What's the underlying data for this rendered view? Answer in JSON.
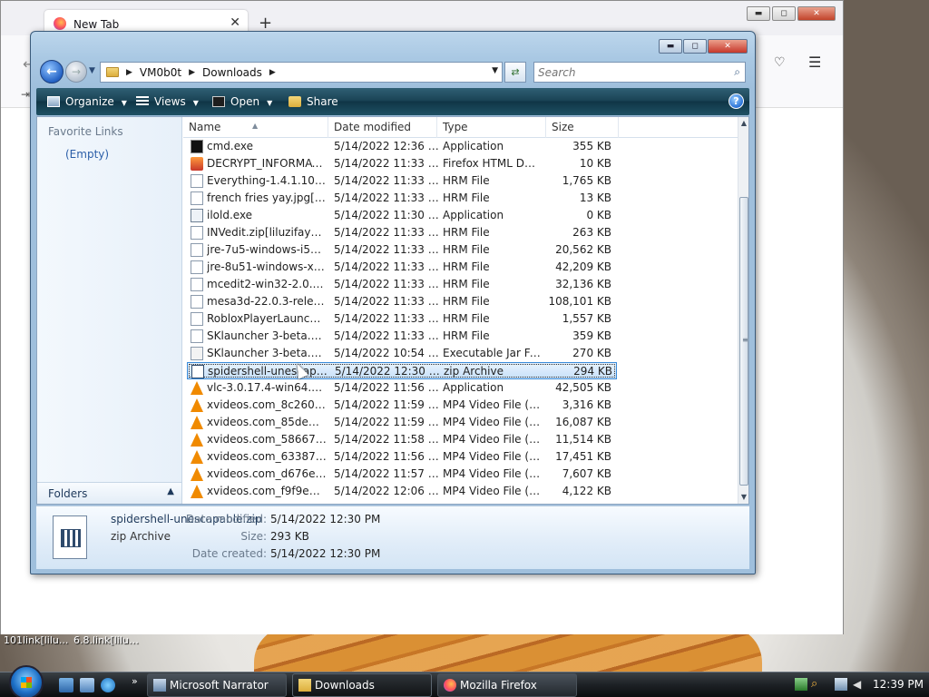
{
  "firefox": {
    "tab_title": "New Tab",
    "tab_close": "✕",
    "new_tab": "+",
    "minimize": "▬",
    "maximize": "◻",
    "close": "✕"
  },
  "explorer": {
    "breadcrumb": [
      "VM0b0t",
      "Downloads"
    ],
    "search_placeholder": "Search",
    "toolbar": {
      "organize": "Organize",
      "views": "Views",
      "open": "Open",
      "share": "Share",
      "help": "?"
    },
    "navpane": {
      "favorite_links": "Favorite Links",
      "empty": "(Empty)",
      "folders": "Folders"
    },
    "columns": {
      "name": "Name",
      "date": "Date modified",
      "type": "Type",
      "size": "Size"
    },
    "files": [
      {
        "name": "cmd.exe",
        "date": "5/14/2022 12:36 PM",
        "type": "Application",
        "size": "355 KB",
        "icon": "cmd"
      },
      {
        "name": "DECRYPT_INFORMATI...",
        "date": "5/14/2022 11:33 AM",
        "type": "Firefox HTML Doc...",
        "size": "10 KB",
        "icon": "html"
      },
      {
        "name": "Everything-1.4.1.1015.x...",
        "date": "5/14/2022 11:33 AM",
        "type": "HRM File",
        "size": "1,765 KB",
        "icon": "blank"
      },
      {
        "name": "french fries yay.jpg[lilu...",
        "date": "5/14/2022 11:33 AM",
        "type": "HRM File",
        "size": "13 KB",
        "icon": "blank"
      },
      {
        "name": "ilold.exe",
        "date": "5/14/2022 11:30 AM",
        "type": "Application",
        "size": "0 KB",
        "icon": "exe"
      },
      {
        "name": "INVedit.zip[liluzifayc@...",
        "date": "5/14/2022 11:33 AM",
        "type": "HRM File",
        "size": "263 KB",
        "icon": "blank"
      },
      {
        "name": "jre-7u5-windows-i586....",
        "date": "5/14/2022 11:33 AM",
        "type": "HRM File",
        "size": "20,562 KB",
        "icon": "blank"
      },
      {
        "name": "jre-8u51-windows-x64....",
        "date": "5/14/2022 11:33 AM",
        "type": "HRM File",
        "size": "42,209 KB",
        "icon": "blank"
      },
      {
        "name": "mcedit2-win32-2.0.0-b...",
        "date": "5/14/2022 11:33 AM",
        "type": "HRM File",
        "size": "32,136 KB",
        "icon": "blank"
      },
      {
        "name": "mesa3d-22.0.3-release...",
        "date": "5/14/2022 11:33 AM",
        "type": "HRM File",
        "size": "108,101 KB",
        "icon": "blank"
      },
      {
        "name": "RobloxPlayerLauncher....",
        "date": "5/14/2022 11:33 AM",
        "type": "HRM File",
        "size": "1,557 KB",
        "icon": "blank"
      },
      {
        "name": "SKlauncher 3-beta.21.e...",
        "date": "5/14/2022 11:33 AM",
        "type": "HRM File",
        "size": "359 KB",
        "icon": "blank"
      },
      {
        "name": "SKlauncher 3-beta.21.jar",
        "date": "5/14/2022 10:54 AM",
        "type": "Executable Jar File",
        "size": "270 KB",
        "icon": "jar"
      },
      {
        "name": "spidershell-unescapabl...",
        "date": "5/14/2022 12:30 PM",
        "type": "zip Archive",
        "size": "294 KB",
        "icon": "zip",
        "selected": true
      },
      {
        "name": "vlc-3.0.17.4-win64.exe",
        "date": "5/14/2022 11:56 AM",
        "type": "Application",
        "size": "42,505 KB",
        "icon": "vlc"
      },
      {
        "name": "xvideos.com_8c2600ee...",
        "date": "5/14/2022 11:59 AM",
        "type": "MP4 Video File (V...",
        "size": "3,316 KB",
        "icon": "vlc"
      },
      {
        "name": "xvideos.com_85defff7f...",
        "date": "5/14/2022 11:59 AM",
        "type": "MP4 Video File (V...",
        "size": "16,087 KB",
        "icon": "vlc"
      },
      {
        "name": "xvideos.com_58667d09...",
        "date": "5/14/2022 11:58 AM",
        "type": "MP4 Video File (V...",
        "size": "11,514 KB",
        "icon": "vlc"
      },
      {
        "name": "xvideos.com_633879d2...",
        "date": "5/14/2022 11:56 AM",
        "type": "MP4 Video File (V...",
        "size": "17,451 KB",
        "icon": "vlc"
      },
      {
        "name": "xvideos.com_d676e92b...",
        "date": "5/14/2022 11:57 AM",
        "type": "MP4 Video File (V...",
        "size": "7,607 KB",
        "icon": "vlc"
      },
      {
        "name": "xvideos.com_f9f9e7fc7...",
        "date": "5/14/2022 12:06 PM",
        "type": "MP4 Video File (V...",
        "size": "4,122 KB",
        "icon": "vlc"
      }
    ],
    "details": {
      "name": "spidershell-unescapable.zip",
      "type": "zip Archive",
      "date_modified_label": "Date modified:",
      "date_modified": "5/14/2022 12:30 PM",
      "size_label": "Size:",
      "size": "293 KB",
      "date_created_label": "Date created:",
      "date_created": "5/14/2022 12:30 PM"
    }
  },
  "desktop": {
    "icon1": "101link[lilu...",
    "icon2": "6.8.link[liluzi..."
  },
  "taskbar": {
    "narrator": "Microsoft Narrator",
    "downloads": "Downloads",
    "firefox": "Mozilla Firefox",
    "clock": "12:39 PM"
  }
}
